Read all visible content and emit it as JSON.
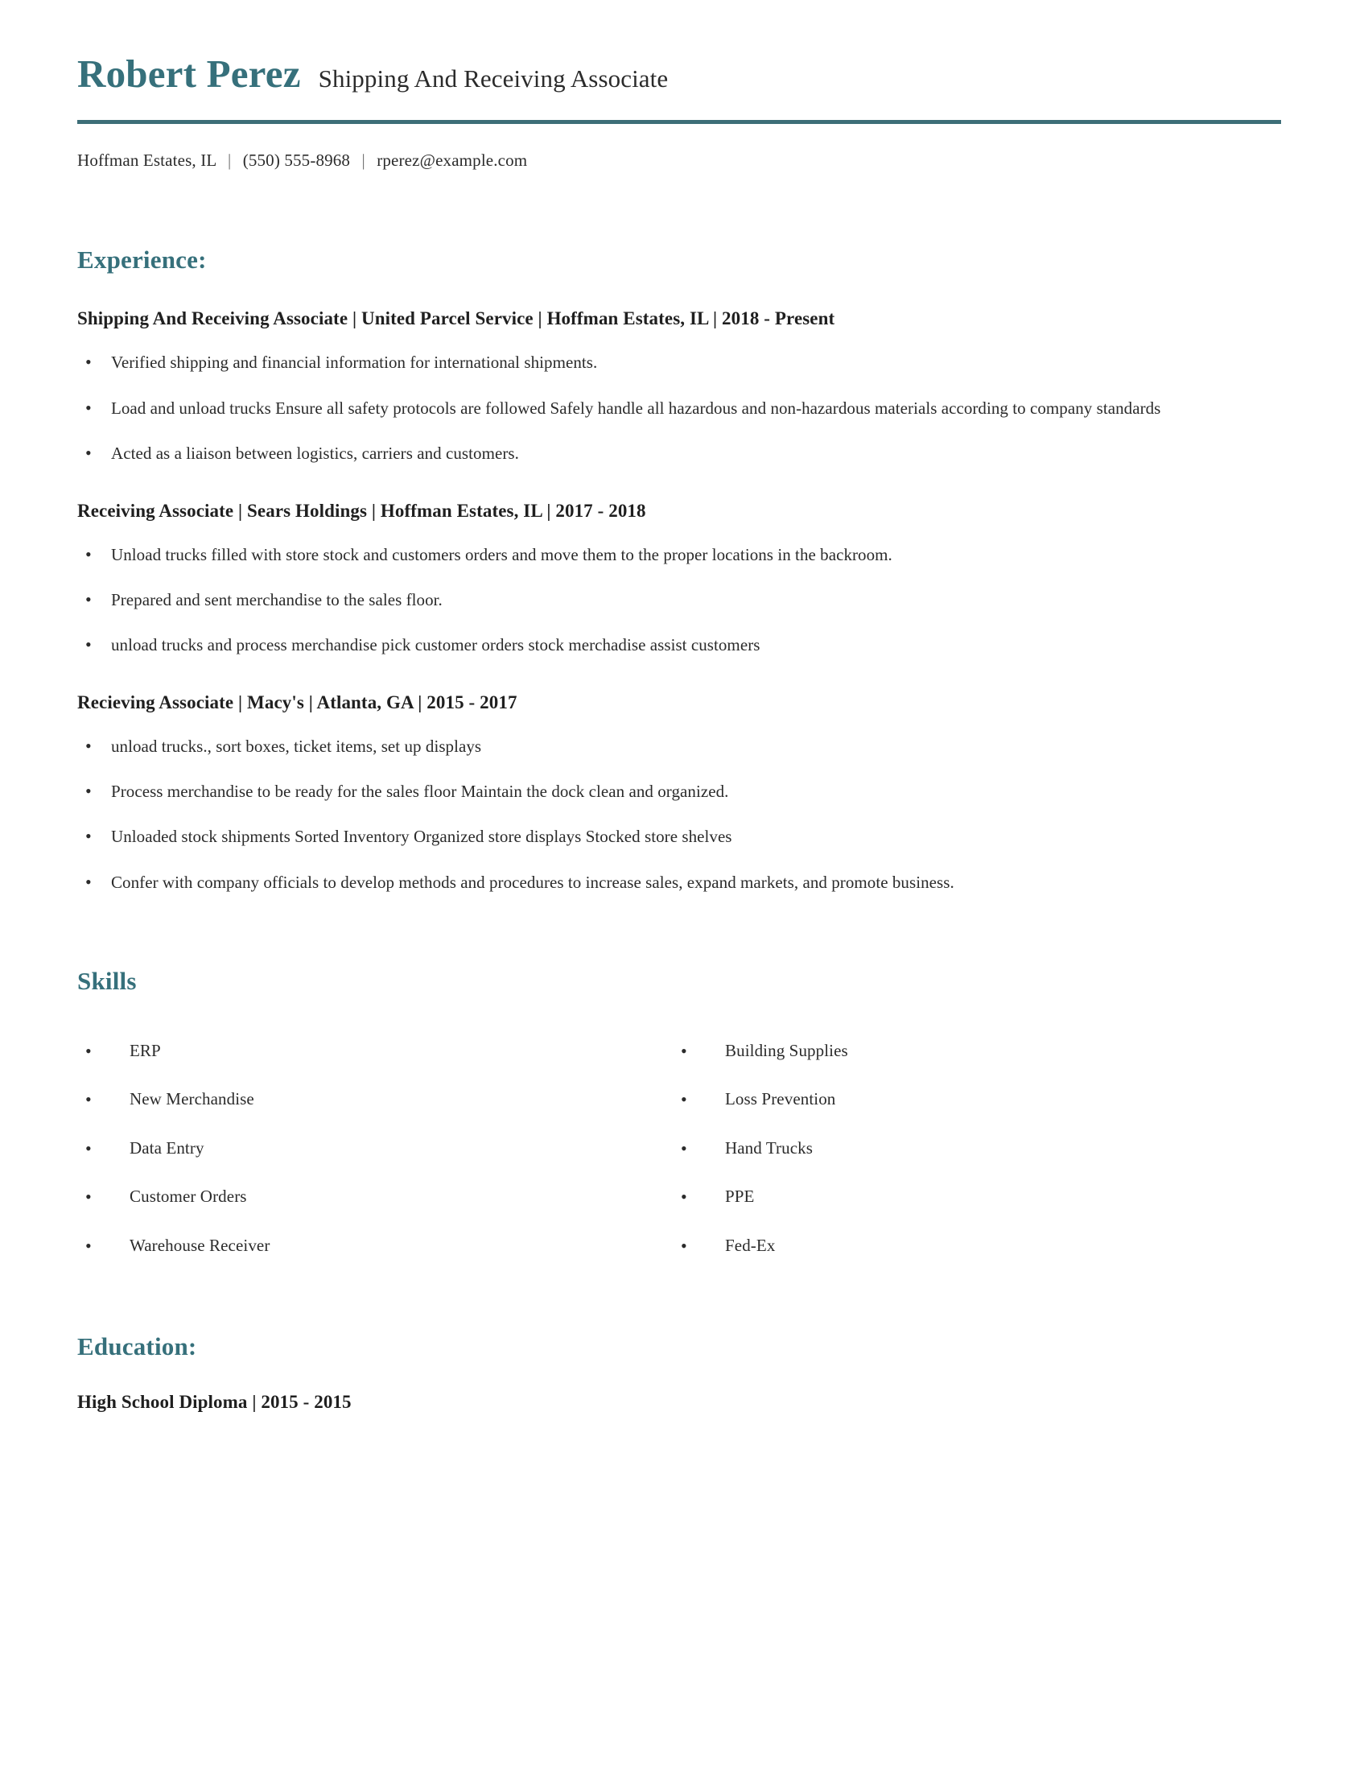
{
  "theme": {
    "accent": "#36707b",
    "rule": "#3d6e78",
    "text": "#2b2b2b",
    "heading_text": "#1f1f1f",
    "background": "#ffffff"
  },
  "header": {
    "full_name": "Robert Perez",
    "job_title": "Shipping And Receiving Associate",
    "contact": {
      "location": "Hoffman Estates, IL",
      "phone": "(550) 555-8968",
      "email": "rperez@example.com",
      "separator": "|"
    }
  },
  "experience": {
    "heading": "Experience:",
    "jobs": [
      {
        "heading": "Shipping And Receiving Associate | United Parcel Service | Hoffman Estates, IL | 2018 - Present",
        "bullets": [
          "Verified shipping and financial information for international shipments.",
          "Load and unload trucks Ensure all safety protocols are followed Safely handle all hazardous and non-hazardous materials according to company standards",
          "Acted as a liaison between logistics, carriers and customers."
        ]
      },
      {
        "heading": "Receiving Associate | Sears Holdings | Hoffman Estates, IL | 2017 - 2018",
        "bullets": [
          "Unload trucks filled with store stock and customers orders and move them to the proper locations in the backroom.",
          "Prepared and sent merchandise to the sales floor.",
          "unload trucks and process merchandise pick customer orders stock merchadise assist customers"
        ]
      },
      {
        "heading": "Recieving Associate | Macy's | Atlanta, GA | 2015 - 2017",
        "bullets": [
          "unload trucks., sort boxes, ticket items, set up displays",
          "Process merchandise to be ready for the sales floor Maintain the dock clean and organized.",
          "Unloaded stock shipments Sorted Inventory Organized store displays Stocked store shelves",
          "Confer with company officials to develop methods and procedures to increase sales, expand markets, and promote business."
        ]
      }
    ]
  },
  "skills": {
    "heading": "Skills",
    "column_left": [
      "ERP",
      "New Merchandise",
      "Data Entry",
      "Customer Orders",
      "Warehouse Receiver"
    ],
    "column_right": [
      "Building Supplies",
      "Loss Prevention",
      "Hand Trucks",
      "PPE",
      "Fed-Ex"
    ]
  },
  "education": {
    "heading": "Education:",
    "entries": [
      "High School Diploma | 2015 - 2015"
    ]
  }
}
